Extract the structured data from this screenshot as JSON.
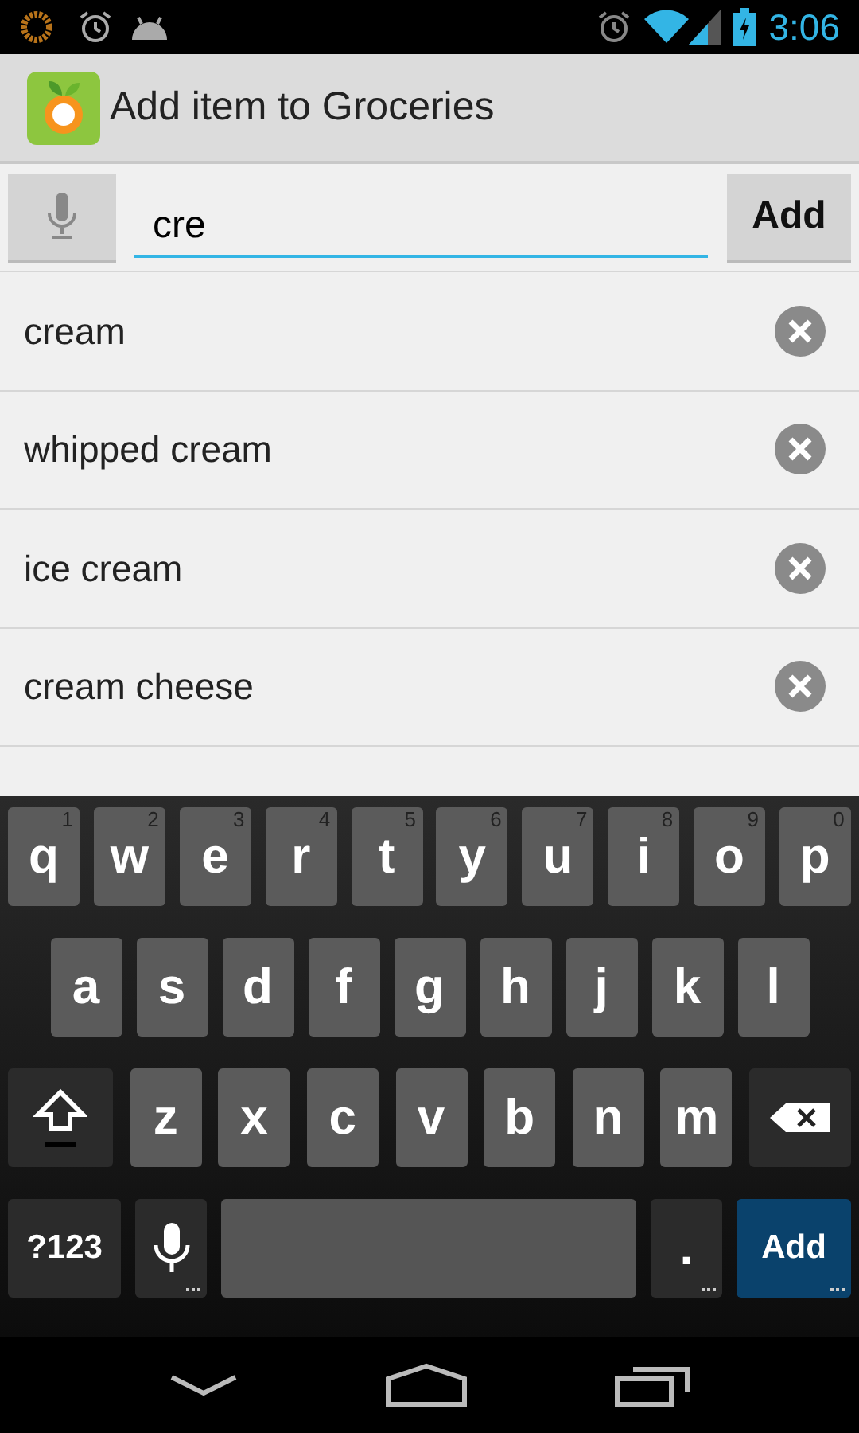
{
  "status_bar": {
    "time": "3:06"
  },
  "action_bar": {
    "title": "Add item to Groceries"
  },
  "entry": {
    "value": "cre",
    "button": "Add"
  },
  "suggestions": [
    {
      "label": "cream"
    },
    {
      "label": "whipped cream"
    },
    {
      "label": "ice cream"
    },
    {
      "label": "cream cheese"
    }
  ],
  "keyboard": {
    "rows": [
      {
        "keys": [
          {
            "kind": "letter",
            "label": "q",
            "hint": "1"
          },
          {
            "kind": "letter",
            "label": "w",
            "hint": "2"
          },
          {
            "kind": "letter",
            "label": "e",
            "hint": "3"
          },
          {
            "kind": "letter",
            "label": "r",
            "hint": "4"
          },
          {
            "kind": "letter",
            "label": "t",
            "hint": "5"
          },
          {
            "kind": "letter",
            "label": "y",
            "hint": "6"
          },
          {
            "kind": "letter",
            "label": "u",
            "hint": "7"
          },
          {
            "kind": "letter",
            "label": "i",
            "hint": "8"
          },
          {
            "kind": "letter",
            "label": "o",
            "hint": "9"
          },
          {
            "kind": "letter",
            "label": "p",
            "hint": "0"
          }
        ]
      },
      {
        "keys": [
          {
            "kind": "letter",
            "label": "a"
          },
          {
            "kind": "letter",
            "label": "s"
          },
          {
            "kind": "letter",
            "label": "d"
          },
          {
            "kind": "letter",
            "label": "f"
          },
          {
            "kind": "letter",
            "label": "g"
          },
          {
            "kind": "letter",
            "label": "h"
          },
          {
            "kind": "letter",
            "label": "j"
          },
          {
            "kind": "letter",
            "label": "k"
          },
          {
            "kind": "letter",
            "label": "l"
          }
        ]
      },
      {
        "keys": [
          {
            "kind": "shift"
          },
          {
            "kind": "letter",
            "label": "z"
          },
          {
            "kind": "letter",
            "label": "x"
          },
          {
            "kind": "letter",
            "label": "c"
          },
          {
            "kind": "letter",
            "label": "v"
          },
          {
            "kind": "letter",
            "label": "b"
          },
          {
            "kind": "letter",
            "label": "n"
          },
          {
            "kind": "letter",
            "label": "m"
          },
          {
            "kind": "backspace"
          }
        ]
      },
      {
        "keys": [
          {
            "kind": "symbols",
            "label": "?123",
            "more": false
          },
          {
            "kind": "voice",
            "more": true
          },
          {
            "kind": "space",
            "more": false
          },
          {
            "kind": "period",
            "label": ".",
            "more": true
          },
          {
            "kind": "action",
            "label": "Add",
            "more": true
          }
        ]
      }
    ]
  }
}
